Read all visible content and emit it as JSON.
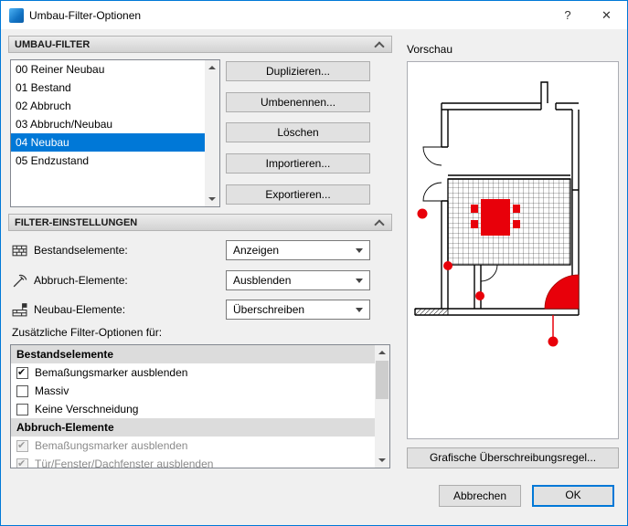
{
  "window": {
    "title": "Umbau-Filter-Optionen",
    "help": "?",
    "close": "✕"
  },
  "umbau_filter": {
    "header": "UMBAU-FILTER",
    "items": [
      {
        "label": "00 Reiner Neubau",
        "selected": false
      },
      {
        "label": "01 Bestand",
        "selected": false
      },
      {
        "label": "02 Abbruch",
        "selected": false
      },
      {
        "label": "03 Abbruch/Neubau",
        "selected": false
      },
      {
        "label": "04 Neubau",
        "selected": true
      },
      {
        "label": "05 Endzustand",
        "selected": false
      }
    ],
    "buttons": {
      "duplicate": "Duplizieren...",
      "rename": "Umbenennen...",
      "delete": "Löschen",
      "import": "Importieren...",
      "export": "Exportieren..."
    }
  },
  "filter_settings": {
    "header": "FILTER-EINSTELLUNGEN",
    "rows": [
      {
        "label": "Bestandselemente:",
        "value": "Anzeigen",
        "icon": "existing-elements-icon"
      },
      {
        "label": "Abbruch-Elemente:",
        "value": "Ausblenden",
        "icon": "demolition-elements-icon"
      },
      {
        "label": "Neubau-Elemente:",
        "value": "Überschreiben",
        "icon": "new-elements-icon"
      }
    ],
    "additional_options_label": "Zusätzliche Filter-Optionen für:",
    "options": [
      {
        "type": "group",
        "label": "Bestandselemente"
      },
      {
        "type": "check",
        "label": "Bemaßungsmarker ausblenden",
        "checked": true,
        "disabled": false
      },
      {
        "type": "check",
        "label": "Massiv",
        "checked": false,
        "disabled": false
      },
      {
        "type": "check",
        "label": "Keine Verschneidung",
        "checked": false,
        "disabled": false
      },
      {
        "type": "group",
        "label": "Abbruch-Elemente"
      },
      {
        "type": "check",
        "label": "Bemaßungsmarker ausblenden",
        "checked": true,
        "disabled": true
      },
      {
        "type": "check",
        "label": "Tür/Fenster/Dachfenster ausblenden",
        "checked": true,
        "disabled": true
      }
    ]
  },
  "preview": {
    "label": "Vorschau",
    "override_button": "Grafische Überschreibungsregel..."
  },
  "footer": {
    "cancel": "Abbrechen",
    "ok": "OK"
  },
  "colors": {
    "accent": "#0078d7",
    "selection": "#0078d7",
    "renovation_red": "#e8000a"
  }
}
